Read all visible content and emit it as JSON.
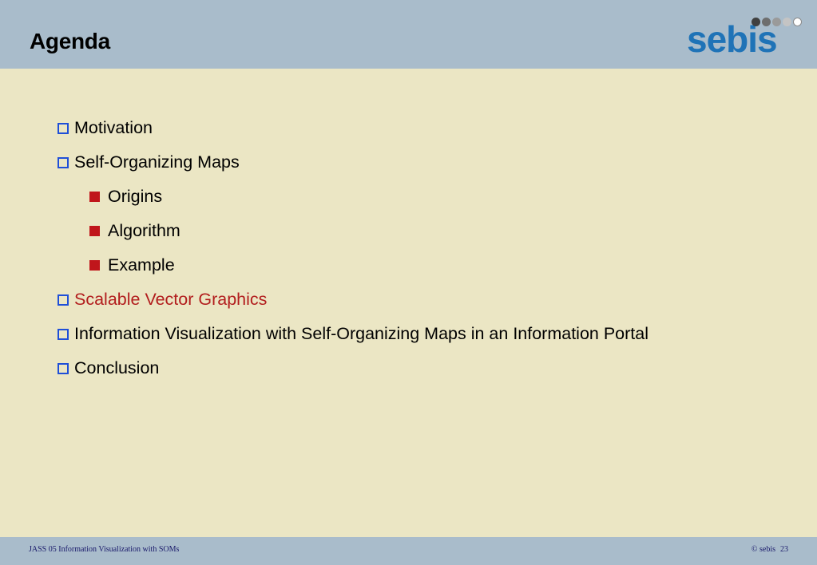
{
  "header": {
    "title": "Agenda",
    "logo_text": "sebis",
    "logo_color": "#1f73b7"
  },
  "agenda": {
    "items": [
      {
        "label": "Motivation",
        "level": 1,
        "highlight": false
      },
      {
        "label": "Self-Organizing Maps",
        "level": 1,
        "highlight": false
      },
      {
        "label": "Origins",
        "level": 2,
        "highlight": false
      },
      {
        "label": "Algorithm",
        "level": 2,
        "highlight": false
      },
      {
        "label": "Example",
        "level": 2,
        "highlight": false
      },
      {
        "label": "Scalable Vector Graphics",
        "level": 1,
        "highlight": true
      },
      {
        "label": "Information Visualization with Self-Organizing Maps in an Information Portal",
        "level": 1,
        "highlight": false
      },
      {
        "label": "Conclusion",
        "level": 1,
        "highlight": false
      }
    ]
  },
  "footer": {
    "left_text": "JASS 05 Information Visualization with SOMs",
    "copyright": "© sebis",
    "page_number": "23"
  },
  "colors": {
    "header_bg": "#a9bccb",
    "content_bg": "#ebe6c4",
    "bullet_level1": "#1f4fd8",
    "bullet_level2": "#c0161b",
    "highlight_text": "#b21d1d"
  }
}
